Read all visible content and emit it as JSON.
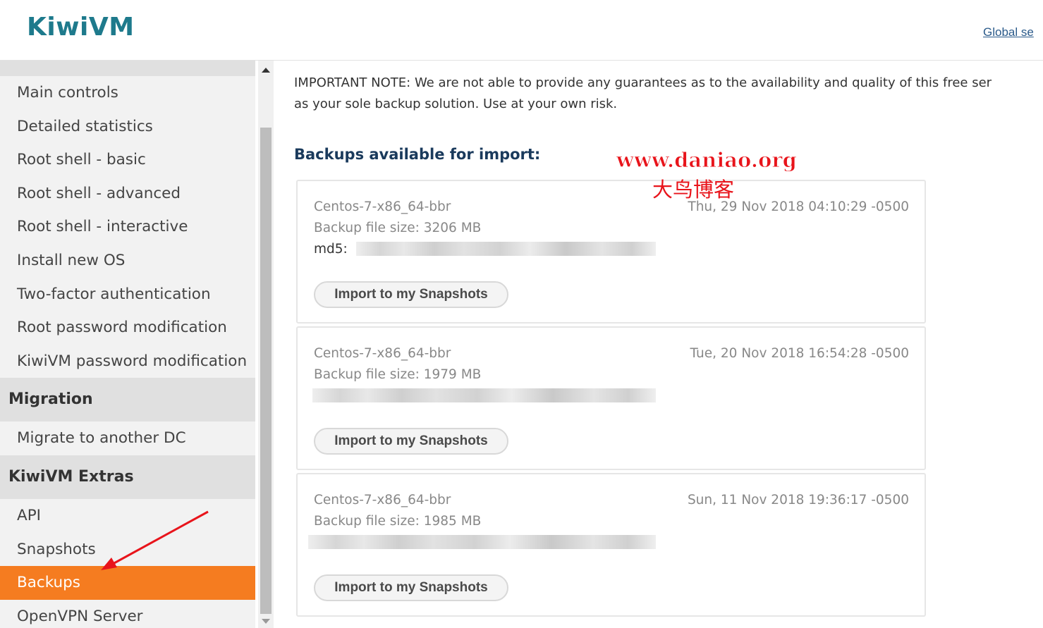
{
  "header": {
    "logo": "KiwiVM",
    "global_link": "Global se"
  },
  "sidebar": {
    "items_top": [
      {
        "label": "Main controls"
      },
      {
        "label": "Detailed statistics"
      },
      {
        "label": "Root shell - basic"
      },
      {
        "label": "Root shell - advanced"
      },
      {
        "label": "Root shell - interactive"
      },
      {
        "label": "Install new OS"
      },
      {
        "label": "Two-factor authentication"
      },
      {
        "label": "Root password modification"
      },
      {
        "label": "KiwiVM password modification"
      }
    ],
    "section_migration": "Migration",
    "items_migration": [
      {
        "label": "Migrate to another DC"
      }
    ],
    "section_extras": "KiwiVM Extras",
    "items_extras": [
      {
        "label": "API"
      },
      {
        "label": "Snapshots"
      },
      {
        "label": "Backups",
        "active": true
      },
      {
        "label": "OpenVPN Server"
      }
    ]
  },
  "main": {
    "note_line1": "IMPORTANT NOTE: We are not able to provide any guarantees as to the availability and quality of this free ser",
    "note_line2": "as your sole backup solution. Use at your own risk.",
    "section_title": "Backups available for import:",
    "watermark_url": "www.daniao.org",
    "watermark_cn": "大鸟博客",
    "backups": [
      {
        "name": "Centos-7-x86_64-bbr",
        "size": "Backup file size: 3206 MB",
        "date": "Thu, 29 Nov 2018 04:10:29 -0500",
        "md5_label": "md5: ",
        "button": "Import to my Snapshots"
      },
      {
        "name": "Centos-7-x86_64-bbr",
        "size": "Backup file size: 1979 MB",
        "date": "Tue, 20 Nov 2018 16:54:28 -0500",
        "md5_label": "",
        "button": "Import to my Snapshots"
      },
      {
        "name": "Centos-7-x86_64-bbr",
        "size": "Backup file size: 1985 MB",
        "date": "Sun, 11 Nov 2018 19:36:17 -0500",
        "md5_label": "",
        "button": "Import to my Snapshots"
      }
    ]
  },
  "colors": {
    "accent": "#f57c20",
    "logo": "#1e7a8c",
    "title": "#1a3a5c",
    "watermark": "#e8141b",
    "arrow": "#e8141b"
  }
}
